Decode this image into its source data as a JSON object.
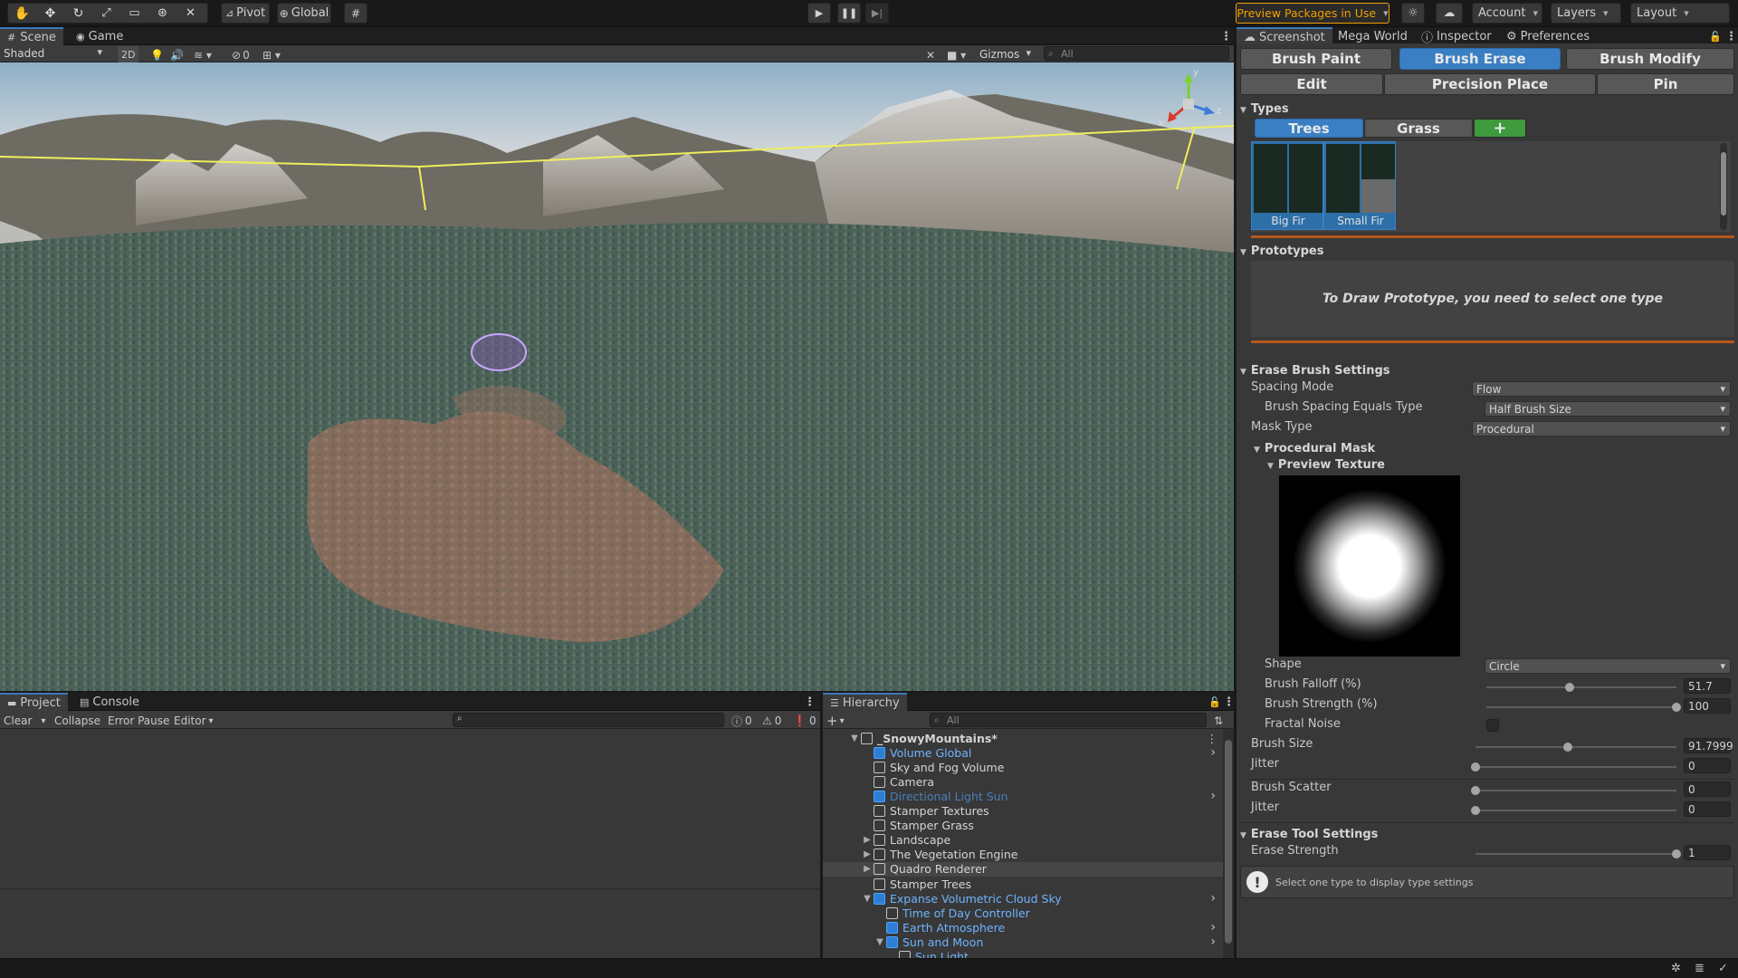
{
  "toolbar": {
    "tools": [
      "hand-tool-icon",
      "move-tool-icon",
      "rotate-tool-icon",
      "scale-tool-icon",
      "rect-tool-icon",
      "transform-tool-icon",
      "custom-tool-icon"
    ],
    "pivot": "Pivot",
    "global": "Global",
    "preview_packages": "Preview Packages in Use",
    "account": "Account",
    "layers": "Layers",
    "layout": "Layout"
  },
  "scene_tabs": {
    "scene": "Scene",
    "game": "Game"
  },
  "scene_bar": {
    "shading": "Shaded",
    "mode2d": "2D",
    "hidden_count": "0",
    "gizmos": "Gizmos",
    "search_placeholder": "All"
  },
  "gizmo_axes": {
    "x": "x",
    "y": "y",
    "z": "z"
  },
  "console_tabs": {
    "project": "Project",
    "console": "Console"
  },
  "console_bar": {
    "clear": "Clear",
    "collapse": "Collapse",
    "error_pause": "Error Pause",
    "editor": "Editor",
    "log_count": "0",
    "warn_count": "0",
    "error_count": "0"
  },
  "hierarchy": {
    "title": "Hierarchy",
    "search_placeholder": "All",
    "items": [
      {
        "label": "_SnowyMountains*",
        "color": "#d4d4d4"
      },
      {
        "label": "Volume Global",
        "color": "#6fb3ff"
      },
      {
        "label": "Sky and Fog Volume",
        "color": "#d4d4d4"
      },
      {
        "label": "Camera",
        "color": "#d4d4d4"
      },
      {
        "label": "Directional Light Sun",
        "color": "#4a7fb8"
      },
      {
        "label": "Stamper Textures",
        "color": "#d4d4d4"
      },
      {
        "label": "Stamper Grass",
        "color": "#d4d4d4"
      },
      {
        "label": "Landscape",
        "color": "#d4d4d4"
      },
      {
        "label": "The Vegetation Engine",
        "color": "#d4d4d4"
      },
      {
        "label": "Quadro Renderer",
        "color": "#d4d4d4"
      },
      {
        "label": "Stamper Trees",
        "color": "#d4d4d4"
      },
      {
        "label": "Expanse Volumetric Cloud Sky",
        "color": "#6fb3ff"
      },
      {
        "label": "Time of Day Controller",
        "color": "#6fb3ff"
      },
      {
        "label": "Earth Atmosphere",
        "color": "#6fb3ff"
      },
      {
        "label": "Sun and Moon",
        "color": "#6fb3ff"
      },
      {
        "label": "Sun Light",
        "color": "#6fb3ff"
      }
    ]
  },
  "inspector_tabs": {
    "screenshot": "Screenshot",
    "mega_world": "Mega World",
    "inspector": "Inspector",
    "preferences": "Preferences"
  },
  "inspector": {
    "brush_paint": "Brush Paint",
    "brush_erase": "Brush Erase",
    "brush_modify": "Brush Modify",
    "edit": "Edit",
    "precision_place": "Precision Place",
    "pin": "Pin",
    "types_header": "Types",
    "trees": "Trees",
    "grass": "Grass",
    "add": "+",
    "thumb_big_fir": "Big Fir",
    "thumb_small_fir": "Small Fir",
    "prototypes_header": "Prototypes",
    "prototypes_msg": "To Draw Prototype, you need to select one type",
    "erase_brush_header": "Erase Brush Settings",
    "spacing_mode_label": "Spacing Mode",
    "spacing_mode_value": "Flow",
    "brush_spacing_label": "Brush Spacing Equals Type",
    "brush_spacing_value": "Half Brush Size",
    "mask_type_label": "Mask Type",
    "mask_type_value": "Procedural",
    "procedural_mask_header": "Procedural Mask",
    "preview_texture_header": "Preview Texture",
    "shape_label": "Shape",
    "shape_value": "Circle",
    "falloff_label": "Brush Falloff (%)",
    "falloff_value": "51.7",
    "falloff_frac": 0.44,
    "strength_label": "Brush Strength (%)",
    "strength_value": "100",
    "strength_frac": 1.0,
    "fractal_label": "Fractal Noise",
    "brush_size_label": "Brush Size",
    "brush_size_value": "91.7999",
    "brush_size_frac": 0.46,
    "jitter1_label": "Jitter",
    "jitter1_value": "0",
    "scatter_label": "Brush Scatter",
    "scatter_value": "0",
    "jitter2_label": "Jitter",
    "jitter2_value": "0",
    "erase_tool_header": "Erase Tool Settings",
    "erase_strength_label": "Erase Strength",
    "erase_strength_value": "1",
    "erase_strength_frac": 1.0,
    "info_msg": "Select one type to display type settings"
  },
  "colors": {
    "accent": "#3a7fc4",
    "separator": "#b5571a",
    "add_button": "#3d9a3d",
    "preview_badge": "#f0a000"
  }
}
